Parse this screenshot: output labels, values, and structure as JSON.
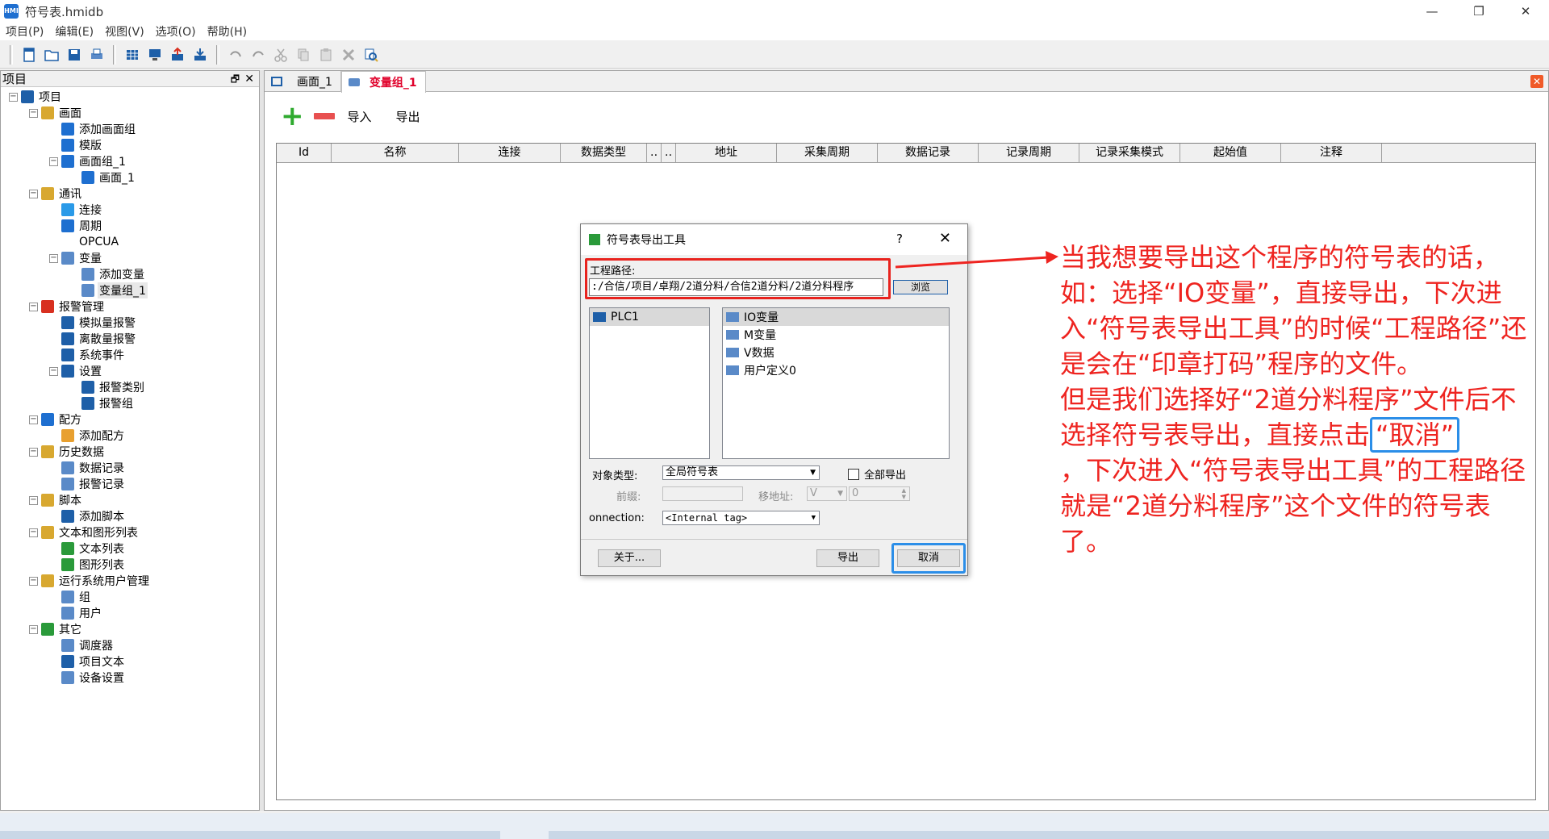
{
  "window": {
    "title": "符号表.hmidb",
    "controls": [
      "—",
      "❐",
      "✕"
    ]
  },
  "menu": [
    "项目(P)",
    "编辑(E)",
    "视图(V)",
    "选项(O)",
    "帮助(H)"
  ],
  "left_panel": {
    "title": "项目",
    "tree": [
      {
        "label": "项目",
        "level": 0,
        "exp": "−",
        "color": "#1e5fa8"
      },
      {
        "label": "画面",
        "level": 1,
        "exp": "−",
        "color": "#d8a830"
      },
      {
        "label": "添加画面组",
        "level": 2,
        "exp": "",
        "color": "#1e6fd0"
      },
      {
        "label": "模版",
        "level": 2,
        "exp": "",
        "color": "#1e6fd0"
      },
      {
        "label": "画面组_1",
        "level": 2,
        "exp": "−",
        "color": "#1e6fd0"
      },
      {
        "label": "画面_1",
        "level": 3,
        "exp": "",
        "color": "#1e6fd0"
      },
      {
        "label": "通讯",
        "level": 1,
        "exp": "−",
        "color": "#d8a830"
      },
      {
        "label": "连接",
        "level": 2,
        "exp": "",
        "color": "#2a9ae8"
      },
      {
        "label": "周期",
        "level": 2,
        "exp": "",
        "color": "#1e6fd0"
      },
      {
        "label": "OPCUA",
        "level": 2,
        "exp": "",
        "color": ""
      },
      {
        "label": "变量",
        "level": 2,
        "exp": "−",
        "color": "#5a8ac8"
      },
      {
        "label": "添加变量",
        "level": 3,
        "exp": "",
        "color": "#5a8ac8"
      },
      {
        "label": "变量组_1",
        "level": 3,
        "exp": "",
        "color": "#5a8ac8",
        "selected": true
      },
      {
        "label": "报警管理",
        "level": 1,
        "exp": "−",
        "color": "#d83020"
      },
      {
        "label": "模拟量报警",
        "level": 2,
        "exp": "",
        "color": "#1e5fa8"
      },
      {
        "label": "离散量报警",
        "level": 2,
        "exp": "",
        "color": "#1e5fa8"
      },
      {
        "label": "系统事件",
        "level": 2,
        "exp": "",
        "color": "#1e5fa8"
      },
      {
        "label": "设置",
        "level": 2,
        "exp": "−",
        "color": "#1e5fa8"
      },
      {
        "label": "报警类别",
        "level": 3,
        "exp": "",
        "color": "#1e5fa8"
      },
      {
        "label": "报警组",
        "level": 3,
        "exp": "",
        "color": "#1e5fa8"
      },
      {
        "label": "配方",
        "level": 1,
        "exp": "−",
        "color": "#1e6fd0"
      },
      {
        "label": "添加配方",
        "level": 2,
        "exp": "",
        "color": "#e8a030"
      },
      {
        "label": "历史数据",
        "level": 1,
        "exp": "−",
        "color": "#d8a830"
      },
      {
        "label": "数据记录",
        "level": 2,
        "exp": "",
        "color": "#5a8ac8"
      },
      {
        "label": "报警记录",
        "level": 2,
        "exp": "",
        "color": "#5a8ac8"
      },
      {
        "label": "脚本",
        "level": 1,
        "exp": "−",
        "color": "#d8a830"
      },
      {
        "label": "添加脚本",
        "level": 2,
        "exp": "",
        "color": "#1e5fa8"
      },
      {
        "label": "文本和图形列表",
        "level": 1,
        "exp": "−",
        "color": "#d8a830"
      },
      {
        "label": "文本列表",
        "level": 2,
        "exp": "",
        "color": "#2a9a3a"
      },
      {
        "label": "图形列表",
        "level": 2,
        "exp": "",
        "color": "#2a9a3a"
      },
      {
        "label": "运行系统用户管理",
        "level": 1,
        "exp": "−",
        "color": "#d8a830"
      },
      {
        "label": "组",
        "level": 2,
        "exp": "",
        "color": "#5a8ac8"
      },
      {
        "label": "用户",
        "level": 2,
        "exp": "",
        "color": "#5a8ac8"
      },
      {
        "label": "其它",
        "level": 1,
        "exp": "−",
        "color": "#2a9a3a"
      },
      {
        "label": "调度器",
        "level": 2,
        "exp": "",
        "color": "#5a8ac8"
      },
      {
        "label": "项目文本",
        "level": 2,
        "exp": "",
        "color": "#1e5fa8"
      },
      {
        "label": "设备设置",
        "level": 2,
        "exp": "",
        "color": "#5a8ac8"
      }
    ]
  },
  "tabs": [
    {
      "label": "画面_1",
      "active": false
    },
    {
      "label": "变量组_1",
      "active": true
    }
  ],
  "main_toolbar": {
    "import_label": "导入",
    "export_label": "导出"
  },
  "grid": {
    "columns": [
      "Id",
      "名称",
      "连接",
      "数据类型",
      "‥",
      "‥",
      "地址",
      "采集周期",
      "数据记录",
      "记录周期",
      "记录采集模式",
      "起始值",
      "注释"
    ]
  },
  "dialog": {
    "title": "符号表导出工具",
    "help": "?",
    "close": "✕",
    "path_label": "工程路径:",
    "path_value": ":/合信/项目/卓翔/2道分料/合信2道分料/2道分料程序",
    "browse_label": "浏览",
    "plc_items": [
      "PLC1"
    ],
    "var_items": [
      "IO变量",
      "M变量",
      "V数据",
      "用户定义0"
    ],
    "object_type_label": "对象类型:",
    "object_type_value": "全局符号表",
    "export_all_label": "全部导出",
    "prefix_label": "前缀:",
    "move_addr_label": "移地址:",
    "move_addr_combo": "V",
    "move_addr_value": "0",
    "connection_label": "onnection:",
    "connection_value": "<Internal tag>",
    "about_label": "关于...",
    "export_label": "导出",
    "cancel_label": "取消"
  },
  "annotation": {
    "part1": "当我想要导出这个程序的符号表的话，如：选择“IO变量”，直接导出，下次进入“符号表导出工具”的时候“工程路径”还是会在“印章打码”程序的文件。",
    "part2": "但是我们选择好“2道分料程序”文件后不选择符号表导出，直接点击",
    "highlight": "“取消”",
    "part3": "，下次进入“符号表导出工具”的工程路径就是“2道分料程序”这个文件的符号表了。"
  },
  "colors": {
    "annotation_red": "#ee2420",
    "highlight_blue": "#2b8ee8",
    "active_tab_red": "#e0002a"
  }
}
